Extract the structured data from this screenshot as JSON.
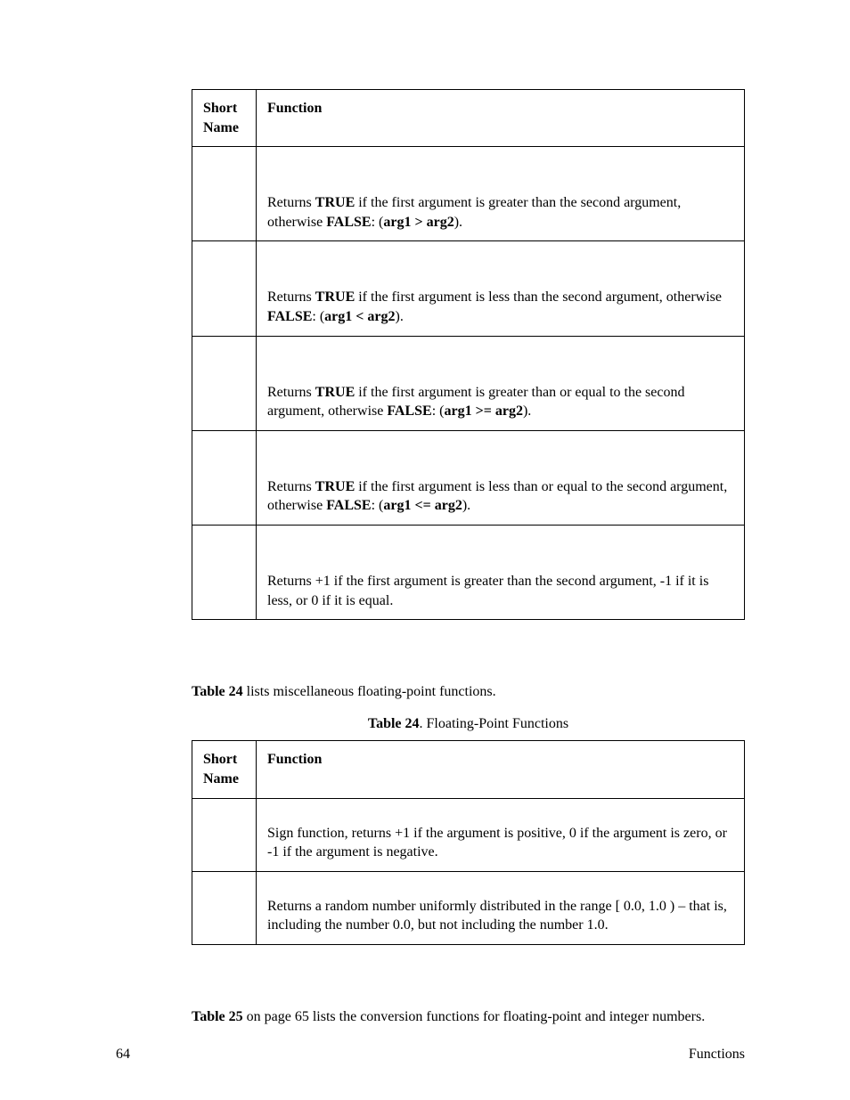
{
  "table23": {
    "headers": {
      "col1": "Short Name",
      "col2": "Function"
    },
    "rows": [
      {
        "pre": "Returns ",
        "r1": "TRUE",
        "mid": " if the first argument is greater than the second argument, otherwise ",
        "r2": "FALSE",
        "sep": ":  (",
        "expr": "arg1 > arg2",
        "post": ")."
      },
      {
        "pre": "Returns ",
        "r1": "TRUE",
        "mid": " if the first argument is less than the second argument, otherwise ",
        "r2": "FALSE",
        "sep": ":  (",
        "expr": "arg1 < arg2",
        "post": ")."
      },
      {
        "pre": "Returns ",
        "r1": "TRUE",
        "mid": " if the first argument is greater than or equal to the second argument, otherwise ",
        "r2": "FALSE",
        "sep": ":  (",
        "expr": "arg1 >= arg2",
        "post": ")."
      },
      {
        "pre": "Returns ",
        "r1": "TRUE",
        "mid": " if the first argument is less than or equal to the second argument, otherwise ",
        "r2": "FALSE",
        "sep": ":  (",
        "expr": "arg1 <= arg2",
        "post": ")."
      },
      {
        "plain": "Returns +1 if the first argument is greater than the second argument, -1 if it is less, or 0 if it is equal."
      }
    ]
  },
  "between1": {
    "ref": "Table 24",
    "rest": " lists miscellaneous floating-point functions."
  },
  "caption24": {
    "ref": "Table 24",
    "rest": ". Floating-Point Functions"
  },
  "table24": {
    "headers": {
      "col1": "Short Name",
      "col2": "Function"
    },
    "rows": [
      {
        "plain": "Sign function, returns +1 if the argument is positive, 0 if the argument is zero, or -1 if the argument is negative."
      },
      {
        "plain": "Returns a random number uniformly distributed in the range [ 0.0, 1.0 ) – that is, including the number 0.0, but not including the number 1.0."
      }
    ]
  },
  "between2": {
    "ref": "Table 25",
    "rest": " on page 65 lists the conversion functions for floating-point and integer numbers."
  },
  "footer": {
    "pageNumber": "64",
    "section": "Functions"
  }
}
